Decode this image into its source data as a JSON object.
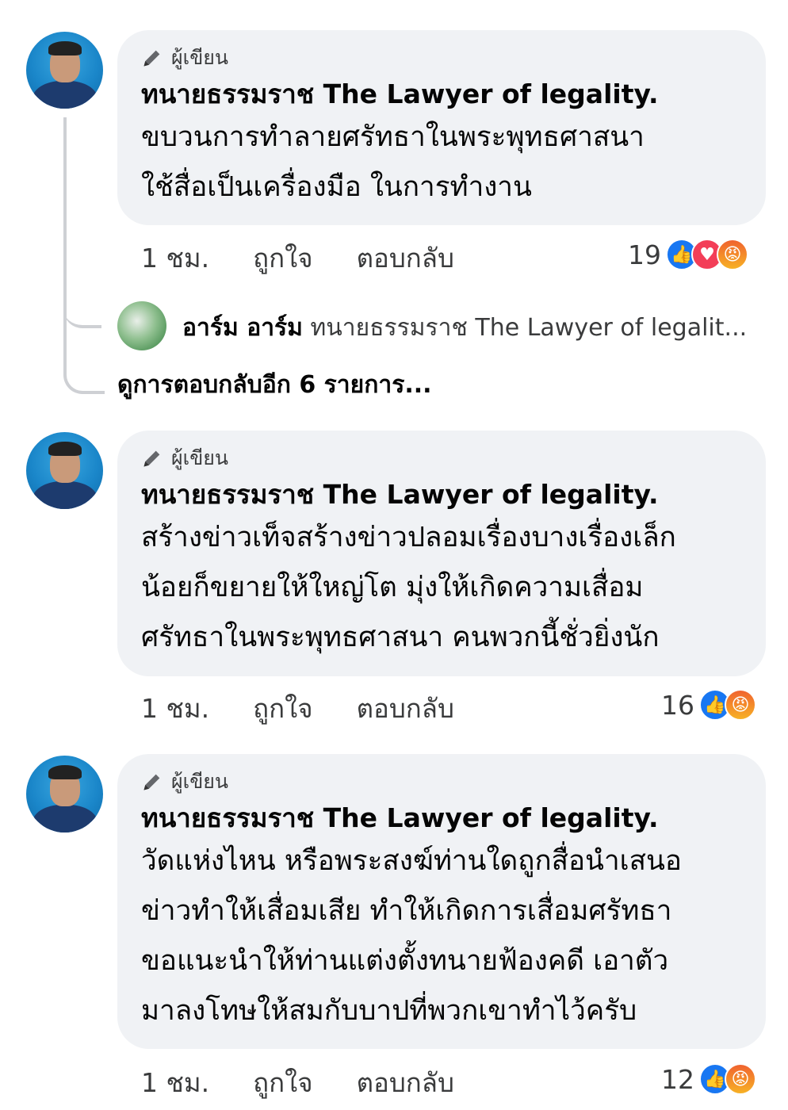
{
  "comments": [
    {
      "author_badge": "ผู้เขียน",
      "name": "ทนายธรรมราช The Lawyer of  legality.",
      "lines": [
        "ขบวนการทำลายศรัทธาในพระพุทธศาสนา",
        "ใช้สื่อเป็นเครื่องมือ ในการทำงาน"
      ],
      "time": "1 ชม.",
      "like_label": "ถูกใจ",
      "reply_label": "ตอบกลับ",
      "reaction_count": "19",
      "reactions": [
        "like-icon",
        "love-icon",
        "angry-icon"
      ]
    },
    {
      "author_badge": "ผู้เขียน",
      "name": "ทนายธรรมราช The Lawyer of  legality.",
      "lines": [
        "สร้างข่าวเท็จสร้างข่าวปลอมเรื่องบางเรื่องเล็ก",
        "น้อยก็ขยายให้ใหญ่โต มุ่งให้เกิดความเสื่อม",
        "ศรัทธาในพระพุทธศาสนา คนพวกนี้ชั่วยิ่งนัก"
      ],
      "time": "1 ชม.",
      "like_label": "ถูกใจ",
      "reply_label": "ตอบกลับ",
      "reaction_count": "16",
      "reactions": [
        "like-icon",
        "angry-icon"
      ]
    },
    {
      "author_badge": "ผู้เขียน",
      "name": "ทนายธรรมราช The Lawyer of  legality.",
      "lines": [
        "วัดแห่งไหน หรือพระสงฆ์ท่านใดถูกสื่อนำเสนอ",
        "ข่าวทำให้เสื่อมเสีย ทำให้เกิดการเสื่อมศรัทธา",
        "ขอแนะนำให้ท่านแต่งตั้งทนายฟ้องคดี เอาตัว",
        "มาลงโทษให้สมกับบาปที่พวกเขาทำไว้ครับ"
      ],
      "time": "1 ชม.",
      "like_label": "ถูกใจ",
      "reply_label": "ตอบกลับ",
      "reaction_count": "12",
      "reactions": [
        "like-icon",
        "angry-icon"
      ]
    }
  ],
  "reply_preview": {
    "name": "อาร์ม อาร์ม",
    "text": "ทนายธรรมราช The Lawyer of legalit..."
  },
  "more_replies": "ดูการตอบกลับอีก 6 รายการ...",
  "colors": {
    "bubble": "#f0f2f5",
    "like": "#1877f2",
    "love": "#f33e58",
    "angry": "#f0632f"
  }
}
